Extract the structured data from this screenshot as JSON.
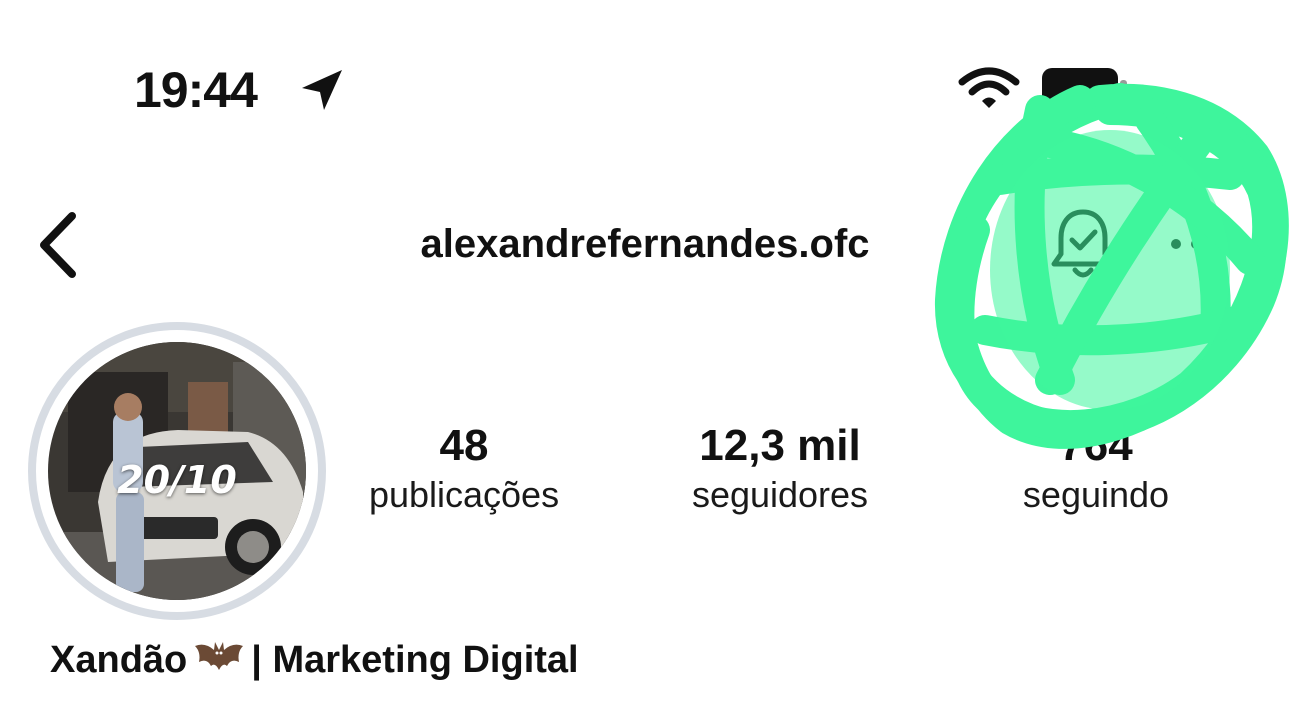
{
  "status_bar": {
    "time": "19:44",
    "icons": [
      "location-arrow-icon",
      "wifi-icon",
      "battery-icon"
    ]
  },
  "header": {
    "username": "alexandrefernandes.ofc",
    "icons": [
      "chevron-left-icon",
      "bell-check-icon",
      "more-horizontal-icon"
    ]
  },
  "profile": {
    "avatar_caption": "20/10",
    "stats": {
      "posts_value": "48",
      "posts_label": "publicações",
      "followers_value": "12,3 mil",
      "followers_label": "seguidores",
      "following_value": "764",
      "following_label": "seguindo"
    },
    "bio": {
      "name_part1": "Xandão",
      "name_icon": "bat-icon",
      "name_part2": "| Marketing Digital"
    }
  },
  "colors": {
    "scribble": "#3ef59c",
    "avatar_ring": "#d7dce3",
    "text": "#111111"
  }
}
